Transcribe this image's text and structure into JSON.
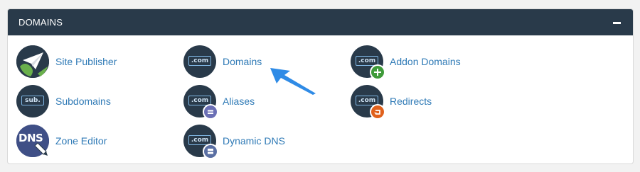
{
  "panel": {
    "title": "DOMAINS",
    "collapse_symbol": "minus"
  },
  "colors": {
    "header_bg": "#293a4a",
    "link": "#2f7ab6",
    "arrow": "#2f8be6",
    "addon_badge": "#3f9b3a",
    "alias_badge": "#6b6fb5",
    "redirect_badge": "#e0611c",
    "dyndns_badge": "#5a6fa3"
  },
  "items": [
    {
      "label": "Site Publisher",
      "icon": "paper-plane-globe-icon"
    },
    {
      "label": "Domains",
      "icon": "dot-com-icon",
      "icon_text": ".com"
    },
    {
      "label": "Addon Domains",
      "icon": "dot-com-plus-icon",
      "icon_text": ".com"
    },
    {
      "label": "Subdomains",
      "icon": "sub-icon",
      "icon_text": "sub."
    },
    {
      "label": "Aliases",
      "icon": "dot-com-alias-icon",
      "icon_text": ".com"
    },
    {
      "label": "Redirects",
      "icon": "dot-com-redirect-icon",
      "icon_text": ".com"
    },
    {
      "label": "Zone Editor",
      "icon": "dns-icon",
      "icon_text": "DNS"
    },
    {
      "label": "Dynamic DNS",
      "icon": "dot-com-dynamic-icon",
      "icon_text": ".com"
    }
  ],
  "annotation": {
    "type": "arrow",
    "points_to": "Domains"
  }
}
